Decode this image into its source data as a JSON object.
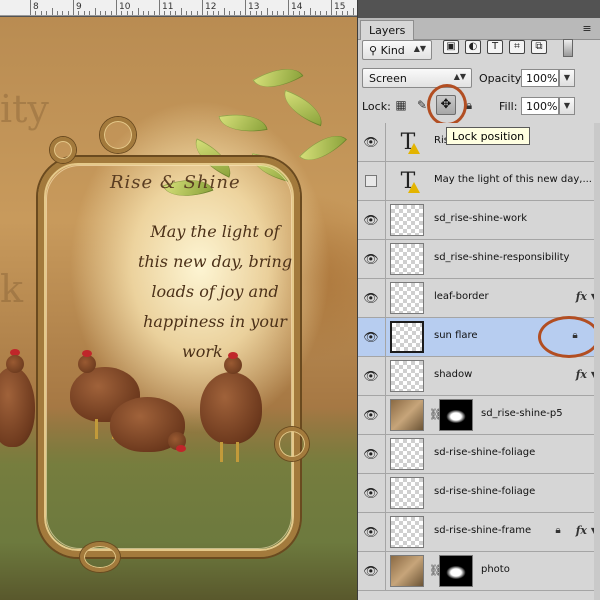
{
  "ruler": {
    "marks": [
      "8",
      "9",
      "10",
      "11",
      "12",
      "13",
      "14",
      "15"
    ]
  },
  "document": {
    "background_words": [
      "ity",
      "k"
    ],
    "title_text": "Rise & Shine",
    "verse_lines": [
      "May the light of",
      "this new day, bring",
      "loads of joy and",
      "happiness in your",
      "work"
    ]
  },
  "panel": {
    "tab_label": "Layers",
    "menu_icon": "panel-menu-icon",
    "filter": {
      "kind_label": "Kind"
    },
    "blend_mode": "Screen",
    "opacity_label": "Opacity:",
    "opacity_value": "100%",
    "lock_label": "Lock:",
    "fill_label": "Fill:",
    "fill_value": "100%",
    "tooltip": "Lock position"
  },
  "layers": [
    {
      "name": "Rise & Shine",
      "visible": true,
      "type": "text",
      "warning": true
    },
    {
      "name": "May the light of  this new day,...",
      "visible": false,
      "type": "text",
      "warning": true
    },
    {
      "name": "sd_rise-shine-work",
      "visible": true,
      "type": "pixel"
    },
    {
      "name": "sd_rise-shine-responsibility",
      "visible": true,
      "type": "pixel"
    },
    {
      "name": "leaf-border",
      "visible": true,
      "type": "pixel",
      "fx": true
    },
    {
      "name": "sun flare",
      "visible": true,
      "type": "pixel",
      "selected": true,
      "locked": true
    },
    {
      "name": "shadow",
      "visible": true,
      "type": "pixel",
      "fx": true
    },
    {
      "name": "sd_rise-shine-p5",
      "visible": true,
      "type": "masked"
    },
    {
      "name": "sd-rise-shine-foliage",
      "visible": true,
      "type": "pixel"
    },
    {
      "name": "sd-rise-shine-foliage",
      "visible": true,
      "type": "pixel"
    },
    {
      "name": "sd-rise-shine-frame",
      "visible": true,
      "type": "pixel",
      "locked": true,
      "fx": true
    },
    {
      "name": "photo",
      "visible": true,
      "type": "masked"
    }
  ],
  "layer_labels": {
    "fx": "fx"
  }
}
